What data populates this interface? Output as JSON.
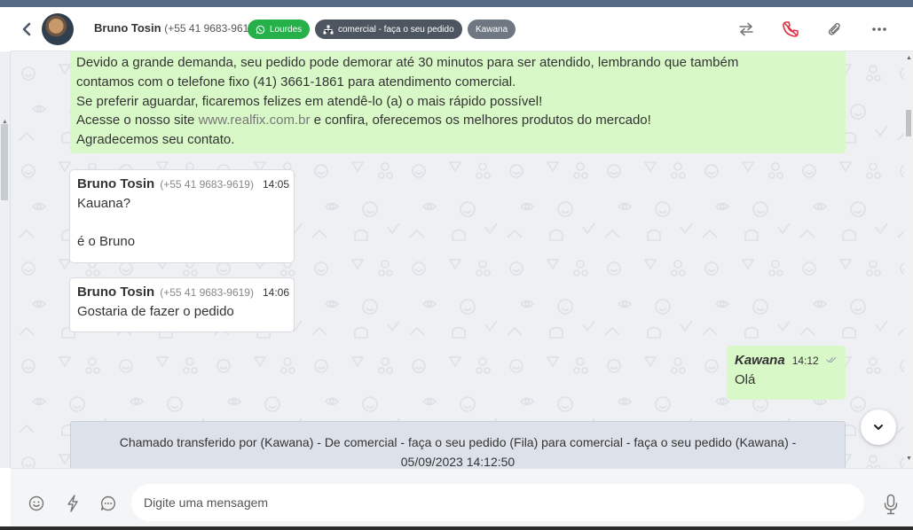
{
  "header": {
    "contact_name": "Bruno Tosin",
    "contact_phone": "(+55 41 9683-9619)",
    "tags": [
      {
        "label": "Lourdes",
        "color": "#25b04a",
        "icon": "whatsapp-icon"
      },
      {
        "label": "comercial - faça o seu pedido",
        "color": "#4d5560",
        "icon": "sitemap-icon"
      },
      {
        "label": "Kawana",
        "color": "#6f7882"
      }
    ],
    "actions": [
      "transfer-icon",
      "end-call-icon",
      "paperclip-icon",
      "more-icon"
    ]
  },
  "system_message": {
    "lines": [
      "Devido a grande demanda, seu pedido pode demorar até 30 minutos para ser atendido, lembrando que também",
      "contamos com o telefone fixo (41) 3661-1861 para atendimento comercial.",
      "Se preferir aguardar, ficaremos felizes em atendê-lo (a) o mais rápido possível!"
    ],
    "site_prefix": "Acesse o nosso site ",
    "site_link": "www.realfix.com.br",
    "site_suffix": " e confira, oferecemos os melhores produtos do mercado!",
    "closing": "Agradecemos seu contato."
  },
  "messages": [
    {
      "author": "Bruno Tosin",
      "phone": "(+55 41 9683-9619)",
      "time": "14:05",
      "line1": "Kauana?",
      "line2": "é o Bruno"
    },
    {
      "author": "Bruno Tosin",
      "phone": "(+55 41 9683-9619)",
      "time": "14:06",
      "text": "Gostaria de fazer o pedido"
    }
  ],
  "outgoing": {
    "author": "Kawana",
    "time": "14:12",
    "text": "Olá",
    "status": "sent"
  },
  "transfer_note": {
    "line1": "Chamado transferido por (Kawana) - De comercial - faça o seu pedido (Fila) para comercial - faça o seu pedido (Kawana) -",
    "line2": "05/09/2023 14:12:50"
  },
  "composer": {
    "placeholder": "Digite uma mensagem",
    "icons": [
      "emoji-icon",
      "bolt-icon",
      "chat-bubble-icon",
      "microphone-icon"
    ]
  },
  "colors": {
    "accent_green": "#25b04a",
    "bubble_green": "#d9f8c7",
    "end_call_red": "#e0344a"
  }
}
